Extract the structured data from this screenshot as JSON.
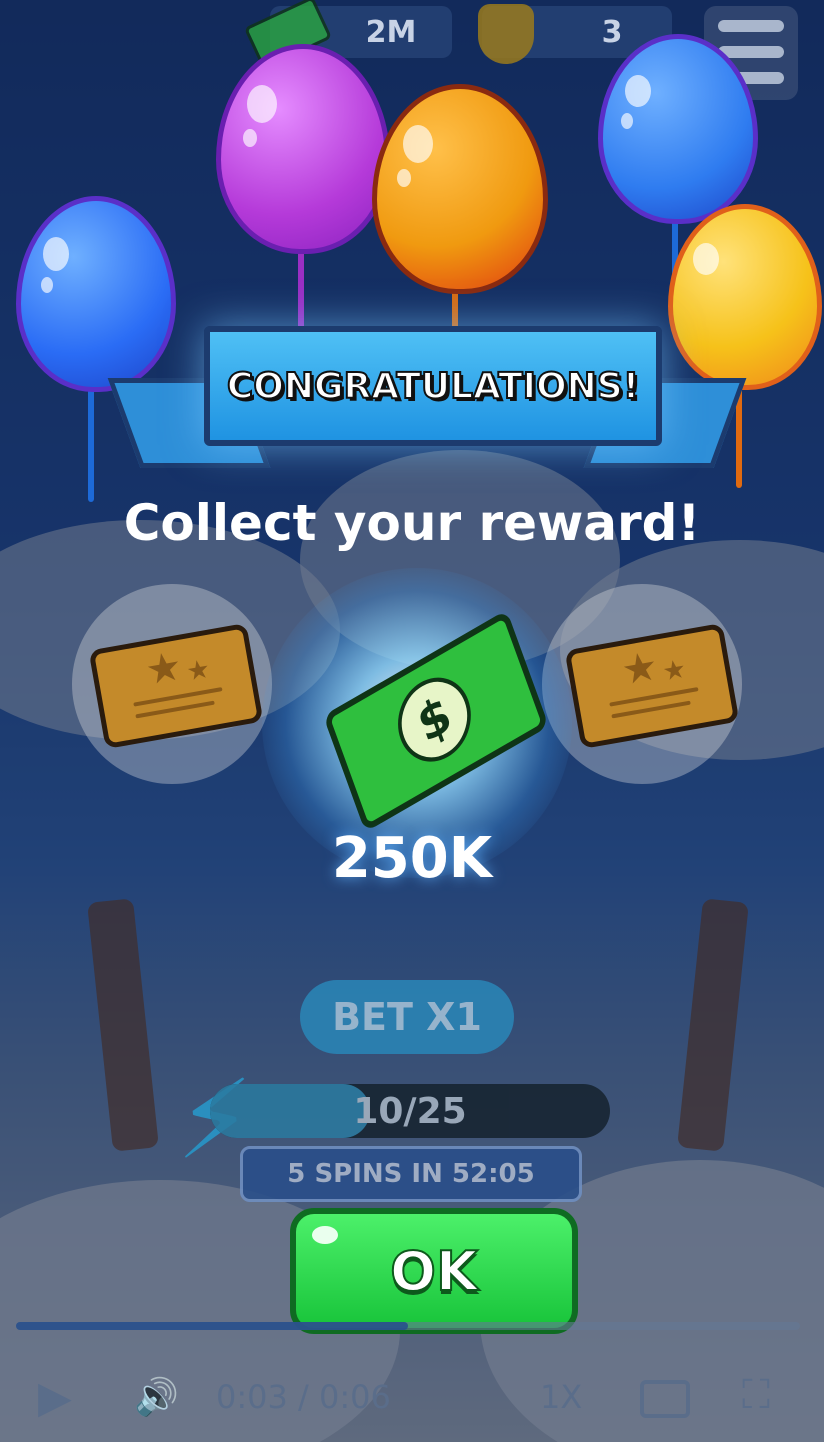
{
  "hud": {
    "cash_amount": "2M",
    "badge_count": "3"
  },
  "banner": {
    "title": "CONGRATULATIONS!"
  },
  "subtitle": "Collect your reward!",
  "reward": {
    "value": "250K",
    "icon": "cash-icon"
  },
  "machine": {
    "bet_label": "BET X1",
    "energy_label": "10/25",
    "energy_fraction": 0.4,
    "spins_label": "5 SPINS IN 52:05"
  },
  "ok_button": {
    "label": "OK"
  },
  "video": {
    "time": "0:03 / 0:06",
    "speed": "1X",
    "progress_fraction": 0.5
  },
  "colors": {
    "ok_green": "#18c43a",
    "banner_blue": "#1f93e2",
    "balloon_colors": [
      "#2a6cf5",
      "#b53ad9",
      "#f09a10",
      "#2f7cf0",
      "#f6c21a"
    ]
  }
}
